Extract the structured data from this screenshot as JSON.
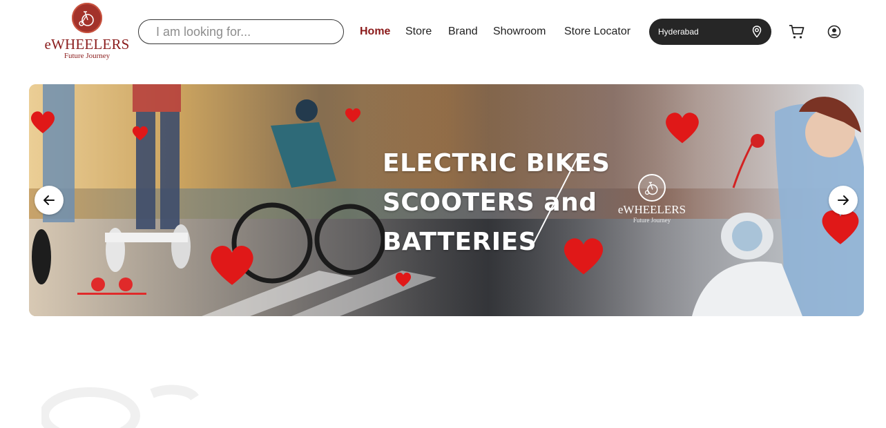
{
  "brand": {
    "name": "eWHEELERS",
    "tagline": "Future Journey",
    "color": "#8b1d1d"
  },
  "search": {
    "placeholder": "I am looking for..."
  },
  "nav": {
    "items": [
      {
        "label": "Home",
        "active": true
      },
      {
        "label": "Store",
        "active": false
      },
      {
        "label": "Brand",
        "active": false
      },
      {
        "label": "Showroom",
        "active": false
      },
      {
        "label": "Store Locator",
        "active": false
      }
    ]
  },
  "location": {
    "city": "Hyderabad",
    "icon": "location-pin-icon"
  },
  "header_icons": {
    "cart": "cart-icon",
    "account": "user-icon"
  },
  "banner": {
    "headline_lines": [
      "ELECTRIC BIKES",
      "SCOOTERS and",
      "BATTERIES"
    ],
    "logo_name": "eWHEELERS",
    "logo_tagline": "Future Journey",
    "prev_icon": "arrow-left-icon",
    "next_icon": "arrow-right-icon",
    "heart_color": "#e01818"
  }
}
